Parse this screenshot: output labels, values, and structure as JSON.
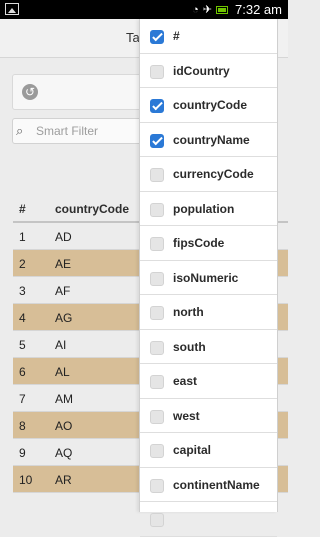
{
  "statusbar": {
    "time": "7:32 am"
  },
  "header": {
    "title": "Ta"
  },
  "filter": {
    "placeholder": "Smart Filter"
  },
  "table": {
    "headers": [
      "#",
      "countryCode"
    ],
    "rows": [
      {
        "num": "1",
        "code": "AD"
      },
      {
        "num": "2",
        "code": "AE"
      },
      {
        "num": "3",
        "code": "AF"
      },
      {
        "num": "4",
        "code": "AG"
      },
      {
        "num": "5",
        "code": "AI"
      },
      {
        "num": "6",
        "code": "AL"
      },
      {
        "num": "7",
        "code": "AM"
      },
      {
        "num": "8",
        "code": "AO"
      },
      {
        "num": "9",
        "code": "AQ"
      },
      {
        "num": "10",
        "code": "AR"
      }
    ]
  },
  "menu": {
    "items": [
      {
        "label": "#",
        "checked": true
      },
      {
        "label": "idCountry",
        "checked": false
      },
      {
        "label": "countryCode",
        "checked": true
      },
      {
        "label": "countryName",
        "checked": true
      },
      {
        "label": "currencyCode",
        "checked": false
      },
      {
        "label": "population",
        "checked": false
      },
      {
        "label": "fipsCode",
        "checked": false
      },
      {
        "label": "isoNumeric",
        "checked": false
      },
      {
        "label": "north",
        "checked": false
      },
      {
        "label": "south",
        "checked": false
      },
      {
        "label": "east",
        "checked": false
      },
      {
        "label": "west",
        "checked": false
      },
      {
        "label": "capital",
        "checked": false
      },
      {
        "label": "continentName",
        "checked": false
      },
      {
        "label": "",
        "checked": false
      }
    ]
  },
  "colors": {
    "rowAlt": "#d7be97",
    "checkbox": "#2b79d6"
  }
}
